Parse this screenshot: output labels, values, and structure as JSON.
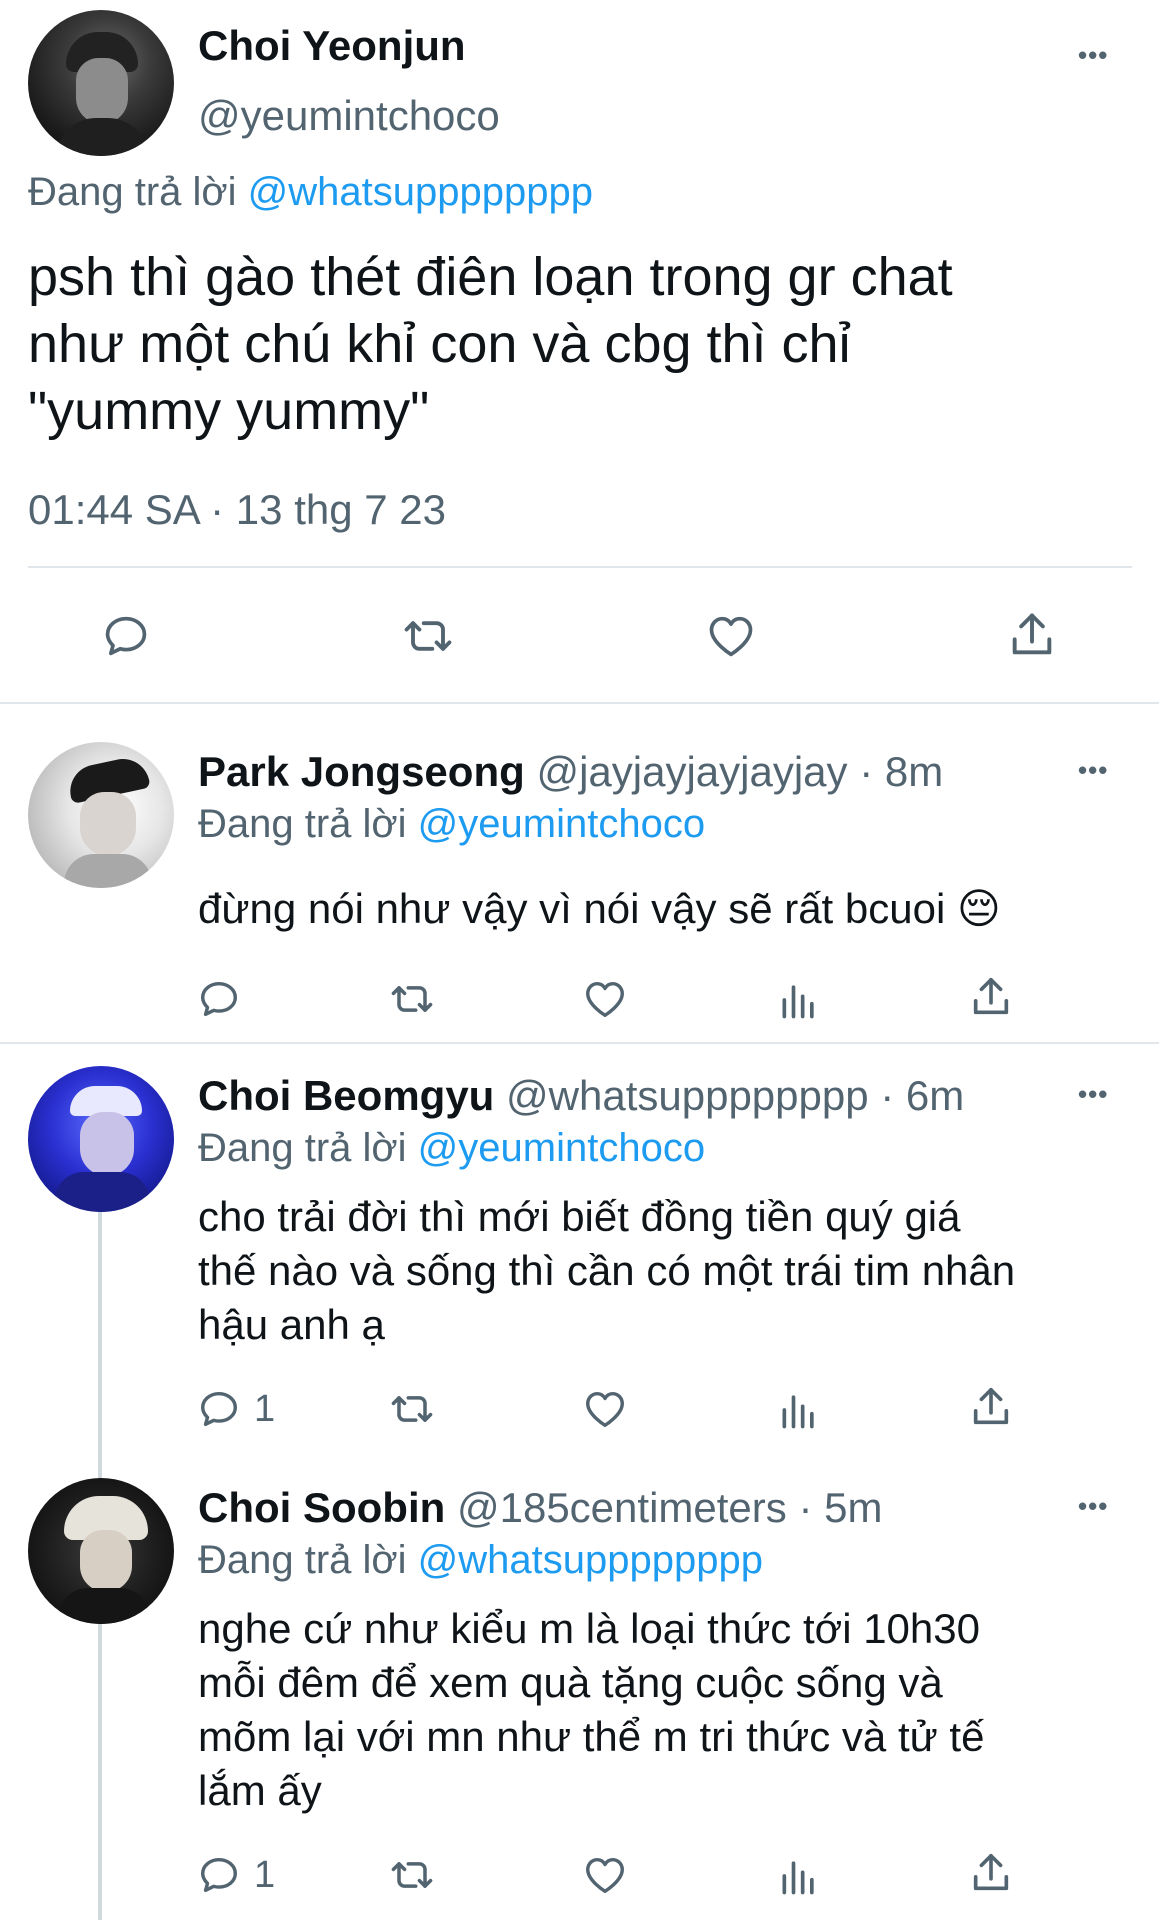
{
  "main_tweet": {
    "display_name": "Choi Yeonjun",
    "handle": "@yeumintchoco",
    "reply_prefix": "Đang trả lời",
    "reply_to": "@whatsupppppppp",
    "text_lines": [
      "psh thì gào thét điên loạn trong gr chat",
      "như một chú khỉ con và cbg thì chỉ",
      "\"yummy yummy\""
    ],
    "timestamp": "01:44 SA · 13 thg 7 23",
    "menu": "•••"
  },
  "replies": [
    {
      "display_name": "Park Jongseong",
      "handle": "@jayjayjayjayjay",
      "time": "· 8m",
      "reply_prefix": "Đang trả lời",
      "reply_to": "@yeumintchoco",
      "text_lines": [
        "đừng nói như vậy vì nói vậy sẽ rất bcuoi 😔"
      ],
      "reply_count": "",
      "menu": "•••"
    },
    {
      "display_name": "Choi Beomgyu",
      "handle": "@whatsupppppppp",
      "time": "· 6m",
      "reply_prefix": "Đang trả lời",
      "reply_to": "@yeumintchoco",
      "text_lines": [
        "cho trải đời thì mới biết đồng tiền quý giá",
        "thế nào và sống thì cần có một trái tim nhân",
        "hậu anh ạ"
      ],
      "reply_count": "1",
      "menu": "•••"
    },
    {
      "display_name": "Choi Soobin",
      "handle": "@185centimeters",
      "time": "· 5m",
      "reply_prefix": "Đang trả lời",
      "reply_to": "@whatsupppppppp",
      "text_lines": [
        "nghe cứ như kiểu m là loại thức tới 10h30",
        "mỗi đêm để xem quà tặng cuộc sống và",
        "mõm lại với mn như thể m tri thức và tử tế",
        "lắm ấy"
      ],
      "reply_count": "1",
      "menu": "•••"
    }
  ],
  "icons": {
    "reply": "reply-icon",
    "retweet": "retweet-icon",
    "like": "heart-icon",
    "views": "analytics-icon",
    "share": "share-icon",
    "menu": "more-icon"
  },
  "colors": {
    "link": "#1d9bf0",
    "muted": "#536471",
    "text": "#0f1419",
    "divider": "#e1e6ea",
    "thread_line": "#cfd9de"
  }
}
